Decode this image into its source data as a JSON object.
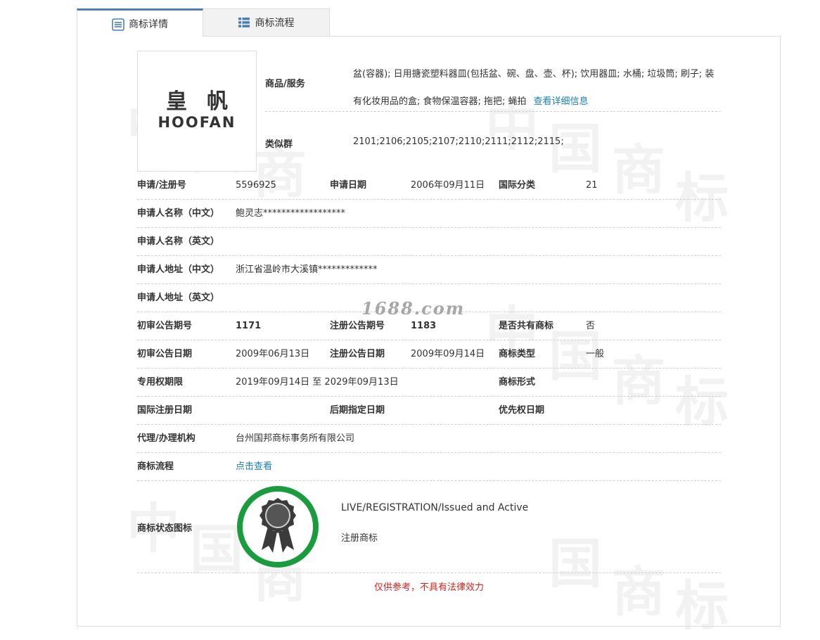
{
  "tabs": [
    {
      "label": "商标详情",
      "icon": "document-list-icon",
      "active": true
    },
    {
      "label": "商标流程",
      "icon": "list-icon",
      "active": false
    }
  ],
  "watermark": {
    "site": "1688.com"
  },
  "logo": {
    "cn": "皇帆",
    "en": "HOOFAN"
  },
  "goods": {
    "label": "商品/服务",
    "text": "盆(容器); 日用搪瓷塑料器皿(包括盆、碗、盘、壶、杯); 饮用器皿; 水桶; 垃圾筒; 刷子; 装有化妆用品的盒; 食物保温容器; 拖把; 蝇拍",
    "link": "查看详细信息"
  },
  "group": {
    "label": "类似群",
    "value": "2101;2106;2105;2107;2110;2111;2112;2115;"
  },
  "rows": {
    "reg_no_label": "申请/注册号",
    "reg_no": "5596925",
    "apply_date_label": "申请日期",
    "apply_date": "2006年09月11日",
    "intl_class_label": "国际分类",
    "intl_class": "21",
    "applicant_cn_label": "申请人名称（中文）",
    "applicant_cn": "鲍灵志******************",
    "applicant_en_label": "申请人名称（英文）",
    "applicant_en": "",
    "address_cn_label": "申请人地址（中文）",
    "address_cn": "浙江省温岭市大溪镇*************",
    "address_en_label": "申请人地址（英文）",
    "address_en": "",
    "prelim_no_label": "初审公告期号",
    "prelim_no": "1171",
    "reg_pub_no_label": "注册公告期号",
    "reg_pub_no": "1183",
    "shared_label": "是否共有商标",
    "shared": "否",
    "prelim_date_label": "初审公告日期",
    "prelim_date": "2009年06月13日",
    "reg_pub_date_label": "注册公告日期",
    "reg_pub_date": "2009年09月14日",
    "tm_type_label": "商标类型",
    "tm_type": "一般",
    "exclusive_label": "专用权期限",
    "exclusive": "2019年09月14日 至 2029年09月13日",
    "tm_form_label": "商标形式",
    "tm_form": "",
    "intl_reg_date_label": "国际注册日期",
    "intl_reg_date": "",
    "later_designation_label": "后期指定日期",
    "later_designation": "",
    "priority_date_label": "优先权日期",
    "priority_date": "",
    "agent_label": "代理/办理机构",
    "agent": "台州国邦商标事务所有限公司",
    "flow_label": "商标流程",
    "flow_link": "点击查看"
  },
  "status": {
    "label": "商标状态图标",
    "en": "LIVE/REGISTRATION/Issued and Active",
    "cn": "注册商标",
    "icon": "registered-badge-icon",
    "ring_color": "#1a9c3e"
  },
  "disclaimer": "仅供参考，不具有法律效力"
}
